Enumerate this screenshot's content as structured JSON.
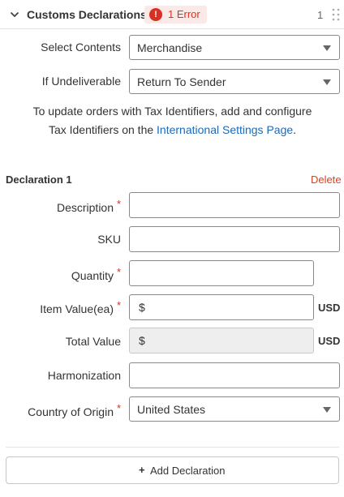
{
  "header": {
    "title": "Customs Declarations",
    "error_icon": "!",
    "error_text": "1 Error",
    "count": "1"
  },
  "fields": {
    "select_contents": {
      "label": "Select Contents",
      "value": "Merchandise"
    },
    "if_undeliverable": {
      "label": "If Undeliverable",
      "value": "Return To Sender"
    }
  },
  "info": {
    "text": "To update orders with Tax Identifiers, add and configure Tax Identifiers on the ",
    "link": "International Settings Page",
    "suffix": "."
  },
  "declaration": {
    "title": "Declaration 1",
    "delete_label": "Delete",
    "required_mark": "*",
    "description": {
      "label": "Description",
      "value": ""
    },
    "sku": {
      "label": "SKU",
      "value": ""
    },
    "quantity": {
      "label": "Quantity",
      "value": ""
    },
    "item_value": {
      "label": "Item Value(ea)",
      "prefix": "$",
      "unit": "USD"
    },
    "total_value": {
      "label": "Total Value",
      "prefix": "$",
      "unit": "USD"
    },
    "harmonization": {
      "label": "Harmonization",
      "value": ""
    },
    "country": {
      "label": "Country of Origin",
      "value": "United States"
    }
  },
  "actions": {
    "add_plus": "+",
    "add_label": "Add Declaration"
  },
  "colors": {
    "error": "#d93025",
    "link": "#1a6bb8",
    "delete": "#e2401c"
  }
}
